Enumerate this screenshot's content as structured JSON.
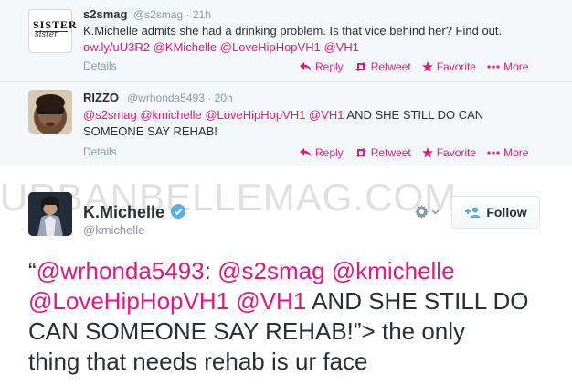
{
  "tweets": [
    {
      "name": "s2smag",
      "handle": "@s2smag",
      "time": "21h",
      "logo_text_1": "SISTER",
      "logo_text_2": "sister",
      "text": "K.Michelle admits she had a drinking problem. Is that vice behind her? Find out.",
      "links": [
        "ow.ly/uU3R2",
        "@KMichelle",
        "@LoveHipHopVH1",
        "@VH1"
      ],
      "details": "Details",
      "actions": {
        "reply": "Reply",
        "retweet": "Retweet",
        "favorite": "Favorite",
        "more": "More"
      }
    },
    {
      "name": "RIZZO",
      "handle": "@wrhonda5493",
      "time": "20h",
      "mentions": [
        "@s2smag",
        "@kmichelle",
        "@LoveHipHopVH1",
        "@VH1"
      ],
      "text_tail": "AND SHE STILL DO CAN",
      "text_line2": "SOMEONE SAY REHAB!",
      "details": "Details",
      "actions": {
        "reply": "Reply",
        "retweet": "Retweet",
        "favorite": "Favorite",
        "more": "More"
      }
    }
  ],
  "watermark": "URBANBELLEMAG.COM",
  "main_tweet": {
    "name": "K.Michelle",
    "handle": "@kmichelle",
    "follow_label": "Follow",
    "open_quote": "“",
    "m1": "@wrhonda5493",
    "colon": ":",
    "m2": "@s2smag",
    "m3": "@kmichelle",
    "m4": "@LoveHipHopVH1",
    "m5": "@VH1",
    "text_a": "AND SHE STILL DO",
    "text_b": "CAN SOMEONE SAY REHAB!”> the only",
    "text_c": "thing that needs rehab is ur face"
  },
  "colors": {
    "link": "#e8167d",
    "muted": "#8899a6",
    "verified": "#55acee"
  },
  "icons": [
    "reply-icon",
    "retweet-icon",
    "favorite-star-icon",
    "more-dots-icon",
    "verified-icon",
    "gear-icon",
    "follow-person-icon"
  ]
}
